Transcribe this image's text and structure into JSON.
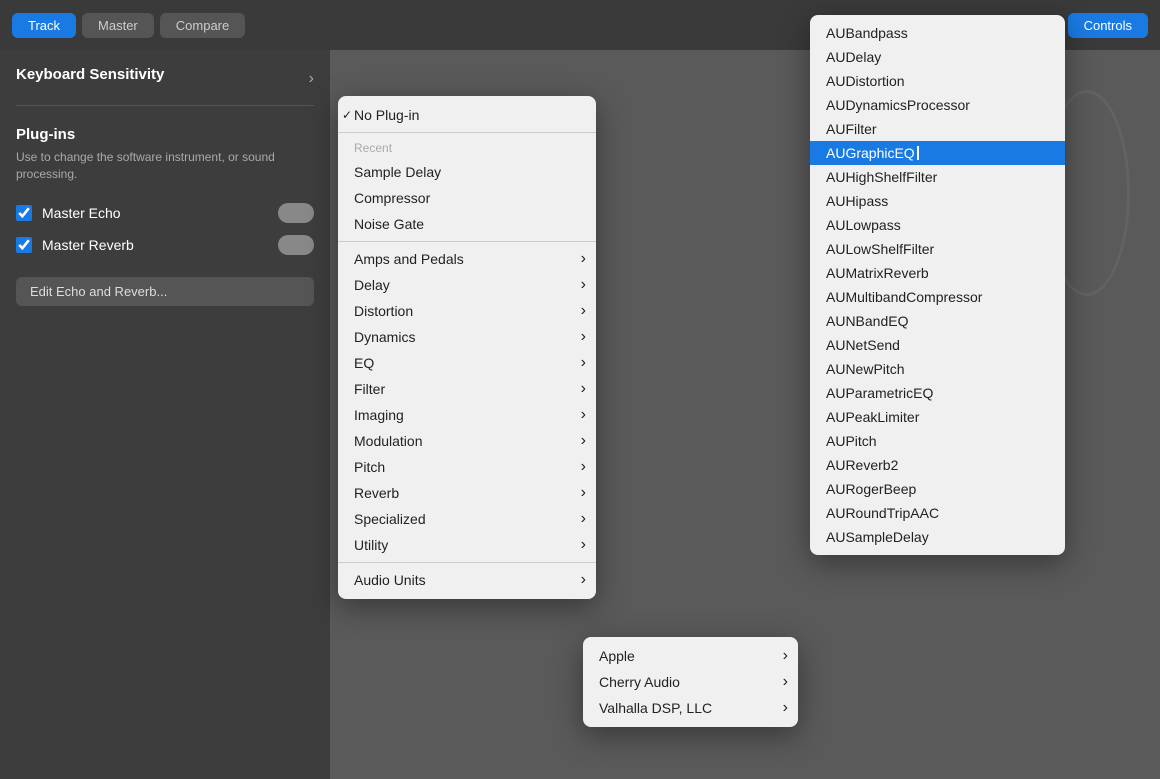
{
  "topbar": {
    "track_label": "Track",
    "master_label": "Master",
    "compare_label": "Compare",
    "controls_label": "Controls"
  },
  "left_panel": {
    "keyboard_sensitivity": "Keyboard Sensitivity",
    "plugins_title": "Plug-ins",
    "plugins_desc": "Use to change the software instrument, or sound processing.",
    "master_echo_label": "Master Echo",
    "master_reverb_label": "Master Reverb",
    "edit_btn_label": "Edit Echo and Reverb..."
  },
  "menu1": {
    "no_plugin_label": "No Plug-in",
    "recent_label": "Recent",
    "items": [
      {
        "label": "Sample Delay",
        "arrow": false
      },
      {
        "label": "Compressor",
        "arrow": false
      },
      {
        "label": "Noise Gate",
        "arrow": false
      }
    ],
    "categories": [
      {
        "label": "Amps and Pedals",
        "arrow": true
      },
      {
        "label": "Delay",
        "arrow": true
      },
      {
        "label": "Distortion",
        "arrow": true
      },
      {
        "label": "Dynamics",
        "arrow": true
      },
      {
        "label": "EQ",
        "arrow": true
      },
      {
        "label": "Filter",
        "arrow": true
      },
      {
        "label": "Imaging",
        "arrow": true
      },
      {
        "label": "Modulation",
        "arrow": true
      },
      {
        "label": "Pitch",
        "arrow": true
      },
      {
        "label": "Reverb",
        "arrow": true
      },
      {
        "label": "Specialized",
        "arrow": true
      },
      {
        "label": "Utility",
        "arrow": true
      }
    ],
    "audio_units_label": "Audio Units",
    "audio_units_arrow": true
  },
  "menu2": {
    "items": [
      {
        "label": "Apple",
        "arrow": true
      },
      {
        "label": "Cherry Audio",
        "arrow": true
      },
      {
        "label": "Valhalla DSP, LLC",
        "arrow": true
      }
    ]
  },
  "menu3": {
    "items": [
      {
        "label": "AUBandpass",
        "highlighted": false
      },
      {
        "label": "AUDelay",
        "highlighted": false
      },
      {
        "label": "AUDistortion",
        "highlighted": false
      },
      {
        "label": "AUDynamicsProcessor",
        "highlighted": false
      },
      {
        "label": "AUFilter",
        "highlighted": false
      },
      {
        "label": "AUGraphicEQ",
        "highlighted": true
      },
      {
        "label": "AUHighShelfFilter",
        "highlighted": false
      },
      {
        "label": "AUHipass",
        "highlighted": false
      },
      {
        "label": "AULowpass",
        "highlighted": false
      },
      {
        "label": "AULowShelfFilter",
        "highlighted": false
      },
      {
        "label": "AUMatrixReverb",
        "highlighted": false
      },
      {
        "label": "AUMultibandCompressor",
        "highlighted": false
      },
      {
        "label": "AUNBandEQ",
        "highlighted": false
      },
      {
        "label": "AUNetSend",
        "highlighted": false
      },
      {
        "label": "AUNewPitch",
        "highlighted": false
      },
      {
        "label": "AUParametricEQ",
        "highlighted": false
      },
      {
        "label": "AUPeakLimiter",
        "highlighted": false
      },
      {
        "label": "AUPitch",
        "highlighted": false
      },
      {
        "label": "AUReverb2",
        "highlighted": false
      },
      {
        "label": "AURogerBeep",
        "highlighted": false
      },
      {
        "label": "AURoundTripAAC",
        "highlighted": false
      },
      {
        "label": "AUSampleDelay",
        "highlighted": false
      }
    ]
  }
}
